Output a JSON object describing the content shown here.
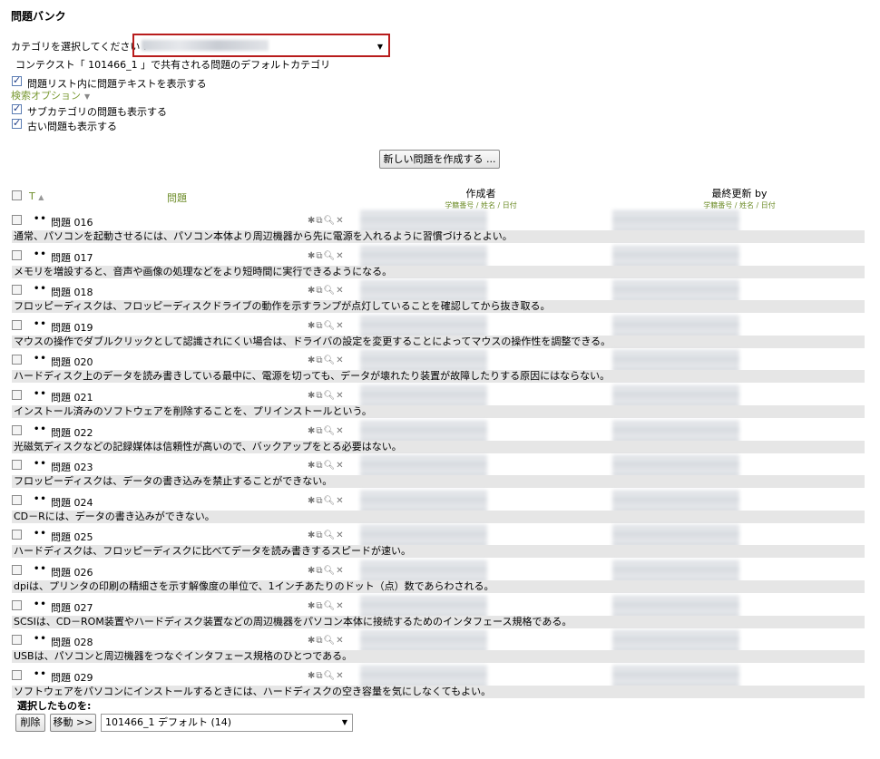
{
  "page_title": "問題バンク",
  "category": {
    "label": "カテゴリを選択してください :",
    "context_line": "コンテクスト「 101466_1 」で共有される問題のデフォルトカテゴリ"
  },
  "options": {
    "show_text": "問題リスト内に問題テキストを表示する",
    "search_options": "検索オプション",
    "show_subcategories": "サブカテゴリの問題も表示する",
    "show_old": "古い問題も表示する"
  },
  "new_question_button": "新しい問題を作成する ...",
  "table_header": {
    "type": "T",
    "question": "問題",
    "created_by": "作成者",
    "created_by_sub": "学籍番号 / 姓名 / 日付",
    "modified_by": "最終更新 by",
    "modified_by_sub": "学籍番号 / 姓名 / 日付"
  },
  "questions": [
    {
      "name": "問題 016",
      "text": "通常、パソコンを起動させるには、パソコン本体より周辺機器から先に電源を入れるように習慣づけるとよい。"
    },
    {
      "name": "問題 017",
      "text": "メモリを増設すると、音声や画像の処理などをより短時間に実行できるようになる。"
    },
    {
      "name": "問題 018",
      "text": "フロッピーディスクは、フロッピーディスクドライブの動作を示すランプが点灯していることを確認してから抜き取る。"
    },
    {
      "name": "問題 019",
      "text": "マウスの操作でダブルクリックとして認識されにくい場合は、ドライバの設定を変更することによってマウスの操作性を調整できる。"
    },
    {
      "name": "問題 020",
      "text": "ハードディスク上のデータを読み書きしている最中に、電源を切っても、データが壊れたり装置が故障したりする原因にはならない。"
    },
    {
      "name": "問題 021",
      "text": "インストール済みのソフトウェアを削除することを、プリインストールという。"
    },
    {
      "name": "問題 022",
      "text": "光磁気ディスクなどの記録媒体は信頼性が高いので、バックアップをとる必要はない。"
    },
    {
      "name": "問題 023",
      "text": "フロッピーディスクは、データの書き込みを禁止することができない。"
    },
    {
      "name": "問題 024",
      "text": "CD－Rには、データの書き込みができない。"
    },
    {
      "name": "問題 025",
      "text": "ハードディスクは、フロッピーディスクに比べてデータを読み書きするスピードが速い。"
    },
    {
      "name": "問題 026",
      "text": "dpiは、プリンタの印刷の精細さを示す解像度の単位で、1インチあたりのドット（点）数であらわされる。"
    },
    {
      "name": "問題 027",
      "text": "SCSIは、CD－ROM装置やハードディスク装置などの周辺機器をパソコン本体に接続するためのインタフェース規格である。"
    },
    {
      "name": "問題 028",
      "text": "USBは、パソコンと周辺機器をつなぐインタフェース規格のひとつである。"
    },
    {
      "name": "問題 029",
      "text": "ソフトウェアをパソコンにインストールするときには、ハードディスクの空き容量を気にしなくてもよい。"
    }
  ],
  "bulk": {
    "label": "選択したものを:",
    "delete_button": "削除",
    "move_button": "移動 >>",
    "move_target": "101466_1 デフォルト (14)"
  }
}
